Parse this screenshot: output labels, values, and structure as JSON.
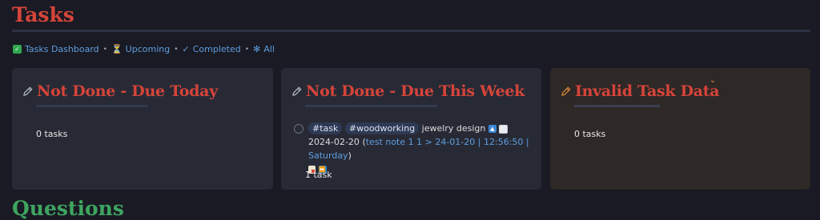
{
  "page": {
    "title": "Tasks",
    "next_heading": "Questions"
  },
  "nav": {
    "dashboard": "Tasks Dashboard",
    "upcoming": "Upcoming",
    "completed": "Completed",
    "all": "All",
    "separator": "•"
  },
  "cards": {
    "due_today": {
      "title": "Not Done - Due Today",
      "count": "0 tasks"
    },
    "due_week": {
      "title": "Not Done - Due This Week",
      "count": "1 task",
      "task": {
        "tag1": "#task",
        "tag2": "#woodworking",
        "text": "jewelry design",
        "date": "2024-02-20",
        "open_paren": "(",
        "link_note": "test note 1 1 > 24-01-20",
        "link_time": "12:56:50",
        "link_day": "Saturday",
        "close_paren": ")"
      }
    },
    "invalid": {
      "title": "Invalid Task Data",
      "count": "0 tasks"
    }
  },
  "colors": {
    "heading_red": "#d6443a",
    "link_blue": "#5f9ee0",
    "heading_green": "#3ea560",
    "card_bg": "#272a35",
    "invalid_card_bg": "#2e2826"
  },
  "icons": {
    "dashboard": "check-box-icon",
    "upcoming": "hourglass-icon",
    "completed": "check-mark-icon",
    "all": "snowflake-icon",
    "card": "pencil-icon"
  }
}
